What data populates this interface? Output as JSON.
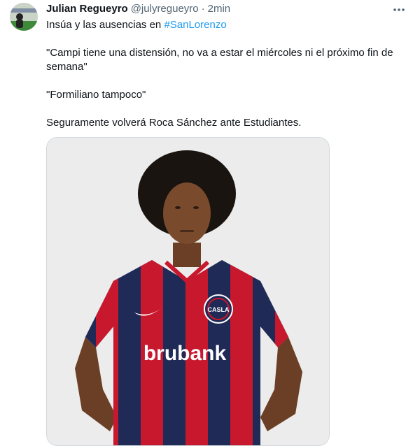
{
  "author": {
    "name": "Julian Regueyro",
    "handle": "@julyregueyro",
    "separator": "·",
    "time": "2min"
  },
  "tweet": {
    "line1_prefix": "Insúa y las ausencias en ",
    "hashtag": "#SanLorenzo",
    "line2": "\"Campi tiene una distensión, no va a estar el miércoles ni el próximo fin de semana\"",
    "line3": "\"Formiliano tampoco\"",
    "line4": "Seguramente volverá Roca Sánchez ante Estudiantes."
  },
  "media": {
    "sponsor": "brubank",
    "crest_text": "CASLA"
  },
  "icons": {
    "more": "more-options-icon"
  },
  "colors": {
    "hashtag": "#1d9bf0",
    "text": "#0f1419",
    "secondary": "#536471",
    "jersey_red": "#c8182e",
    "jersey_blue": "#1f2a56"
  }
}
